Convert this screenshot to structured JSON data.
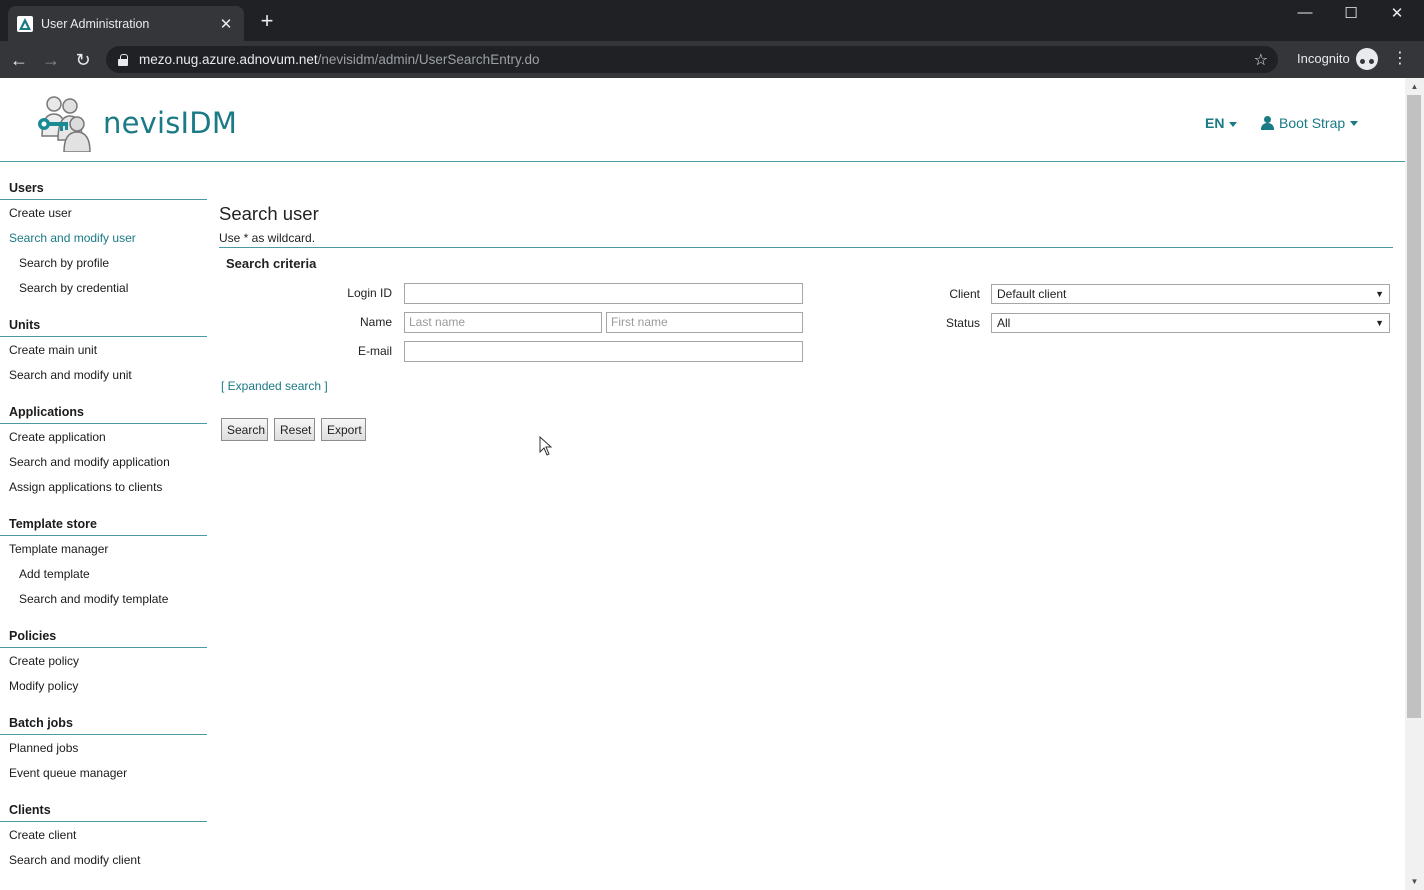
{
  "browser": {
    "tab_title": "User Administration",
    "url_host": "mezo.nug.azure.adnovum.net",
    "url_path": "/nevisidm/admin/UserSearchEntry.do",
    "incognito_label": "Incognito"
  },
  "header": {
    "brand": "nevisIDM",
    "language": "EN",
    "user_name": "Boot Strap"
  },
  "sidebar": {
    "sections": [
      {
        "title": "Users",
        "items": [
          "Create user",
          "Search and modify user",
          "Search by profile",
          "Search by credential"
        ]
      },
      {
        "title": "Units",
        "items": [
          "Create main unit",
          "Search and modify unit"
        ]
      },
      {
        "title": "Applications",
        "items": [
          "Create application",
          "Search and modify application",
          "Assign applications to clients"
        ]
      },
      {
        "title": "Template store",
        "items": [
          "Template manager",
          "Add template",
          "Search and modify template"
        ]
      },
      {
        "title": "Policies",
        "items": [
          "Create policy",
          "Modify policy"
        ]
      },
      {
        "title": "Batch jobs",
        "items": [
          "Planned jobs",
          "Event queue manager"
        ]
      },
      {
        "title": "Clients",
        "items": [
          "Create client",
          "Search and modify client"
        ]
      }
    ]
  },
  "main": {
    "title": "Search user",
    "hint": "Use * as wildcard.",
    "criteria_title": "Search criteria",
    "login_label": "Login ID",
    "login_value": "",
    "name_label": "Name",
    "last_name_placeholder": "Last name",
    "first_name_placeholder": "First name",
    "email_label": "E-mail",
    "email_value": "",
    "client_label": "Client",
    "client_value": "Default client",
    "status_label": "Status",
    "status_value": "All",
    "expanded_search": "[ Expanded search ]",
    "search_button": "Search",
    "reset_button": "Reset",
    "export_button": "Export"
  },
  "colors": {
    "brand_teal": "#1a7a85",
    "chrome_dark": "#202124",
    "chrome_tab": "#35363a"
  }
}
